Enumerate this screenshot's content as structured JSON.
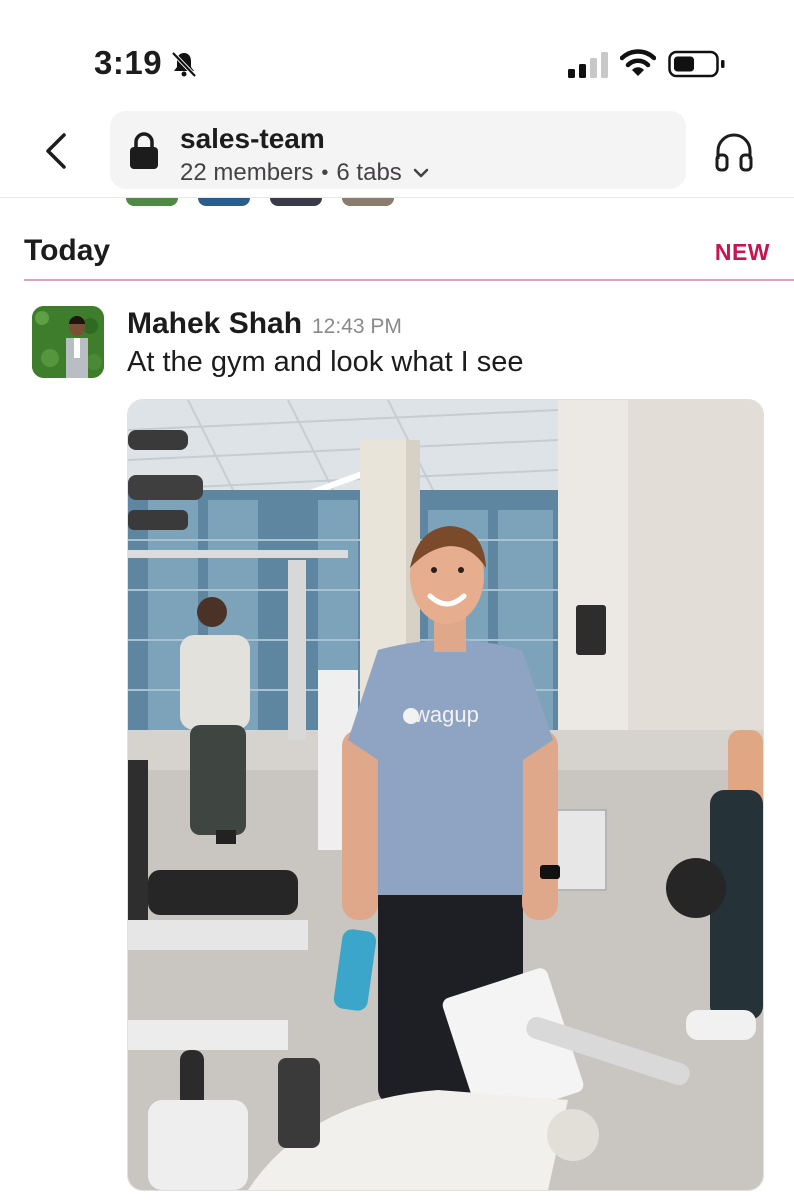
{
  "status_bar": {
    "time": "3:19"
  },
  "header": {
    "channel_name": "sales-team",
    "members": "22 members",
    "separator": "•",
    "tabs": "6 tabs"
  },
  "feed": {
    "day_label": "Today",
    "new_label": "NEW"
  },
  "message": {
    "sender": "Mahek Shah",
    "time": "12:43 PM",
    "text": "At the gym and look what I see",
    "shirt_logo_text": "swagup"
  },
  "icons": [
    "mute-icon",
    "signal-icon",
    "wifi-icon",
    "battery-icon",
    "back-icon",
    "lock-icon",
    "chevron-down-icon",
    "headphones-icon"
  ],
  "colors": {
    "new_accent": "#c8154f",
    "new_divider": "#d9a3bf",
    "pill_bg": "#f4f4f4"
  }
}
